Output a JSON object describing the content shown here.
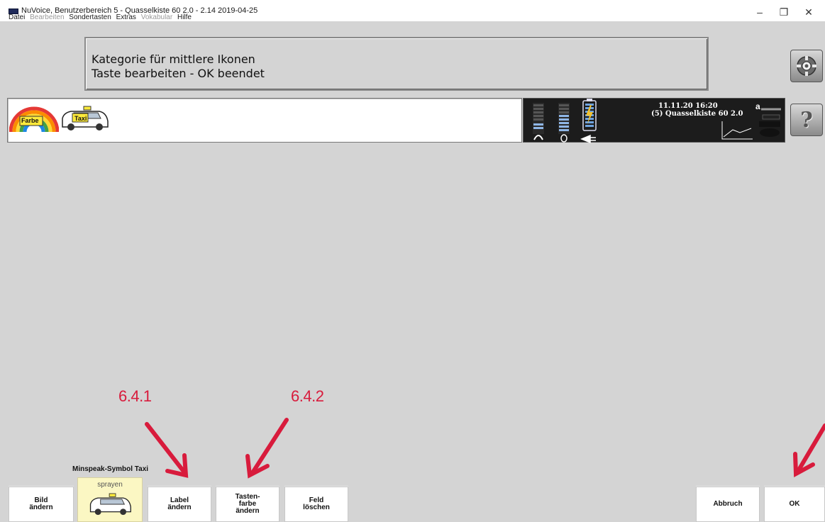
{
  "window": {
    "title": "NuVoice, Benutzerbereich 5 - Quasselkiste 60 2.0 - 2.14 2019-04-25",
    "controls": {
      "minimize": "–",
      "restore": "❐",
      "close": "✕"
    }
  },
  "menu": {
    "items": [
      {
        "label": "Datei",
        "enabled": true
      },
      {
        "label": "Bearbeiten",
        "enabled": false
      },
      {
        "label": "Sondertasten",
        "enabled": true
      },
      {
        "label": "Extras",
        "enabled": true
      },
      {
        "label": "Vokabular",
        "enabled": false
      },
      {
        "label": "Hilfe",
        "enabled": true
      }
    ]
  },
  "info": {
    "line1": "Kategorie für mittlere Ikonen",
    "line2": "Taste bearbeiten - OK beendet"
  },
  "side_buttons": {
    "settings_icon": "gear-icon",
    "help_label": "?"
  },
  "sentence_bar": {
    "icons": [
      {
        "name": "farbe-rainbow-icon",
        "label": "Farbe"
      },
      {
        "name": "taxi-icon",
        "label": "Taxi"
      }
    ]
  },
  "status": {
    "datetime": "11.11.20 16:20",
    "vocabulary": "(5) Quasselkiste 60 2.0",
    "mode_indicator": "a"
  },
  "annotations": {
    "left": "6.4.1",
    "right": "6.4.2"
  },
  "colors": {
    "annotation": "#d81b3c",
    "background": "#d4d4d4",
    "preview_key": "#fbf7c3"
  },
  "symbol": {
    "name": "Minspeak-Symbol Taxi",
    "preview_label": "sprayen",
    "preview_icon": "taxi-icon"
  },
  "buttons": {
    "bild": "Bild\nändern",
    "label": "Label\nändern",
    "tastenfarbe": "Tasten-\nfarbe\nändern",
    "feld": "Feld\nlöschen",
    "abbruch": "Abbruch",
    "ok": "OK"
  }
}
